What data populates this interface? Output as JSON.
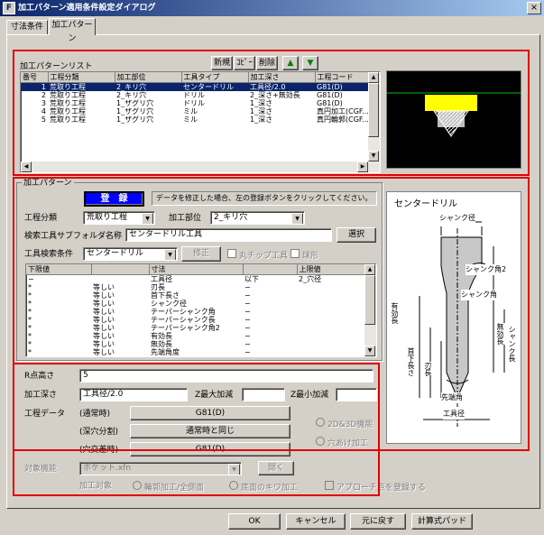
{
  "window": {
    "title": "加工パターン適用条件設定ダイアログ",
    "icon_letter": "F",
    "close": "×"
  },
  "tabs": [
    "寸法条件",
    "加工パターン"
  ],
  "list_section": {
    "label": "加工パターンリスト",
    "buttons": {
      "new": "新規",
      "copy": "ｺﾋﾟｰ",
      "delete": "削除",
      "up": "▲",
      "down": "▼"
    },
    "columns": [
      "番号",
      "工程分類",
      "加工部位",
      "工具タイプ",
      "加工深さ",
      "工程コード"
    ],
    "rows": [
      [
        "1",
        "荒取り工程",
        "2_キリ穴",
        "センタードリル",
        "工具径/2.0",
        "G81(D)"
      ],
      [
        "2",
        "荒取り工程",
        "2_キリ穴",
        "ドリル",
        "2_深さ+無効長",
        "G81(D)"
      ],
      [
        "3",
        "荒取り工程",
        "1_ザグリ穴",
        "ドリル",
        "1_深さ",
        "G81(D)"
      ],
      [
        "4",
        "荒取り工程",
        "1_ザグリ穴",
        "ミル",
        "1_深さ",
        "真円加工(CGF..."
      ],
      [
        "5",
        "荒取り工程",
        "1_ザグリ穴",
        "ミル",
        "1_深さ",
        "真円輪郭(CGF..."
      ]
    ]
  },
  "pattern_section": {
    "label": "加工パターン",
    "register_button": "登　録",
    "register_hint": "データを修正した場合、左の登録ボタンをクリックしてください。",
    "process_class_label": "工程分類",
    "process_class_value": "荒取り工程",
    "machining_part_label": "加工部位",
    "machining_part_value": "2_キリ穴",
    "subfolder_label": "検索工具サブフォルダ名称",
    "subfolder_value": "センタードリル工具",
    "select_button": "選択",
    "tool_search_label": "工具検索条件",
    "tool_search_value": "センタードリル",
    "modify_button": "修正",
    "round_tip_label": "丸チップ工具",
    "chamfer_label": "球形",
    "cond_columns": [
      "下限値",
      "",
      "寸法",
      "",
      "上限値"
    ],
    "cond_rows": [
      [
        "−",
        "",
        "工具径",
        "以下",
        "2_穴径"
      ],
      [
        "*",
        "等しい",
        "刃長",
        "−",
        ""
      ],
      [
        "*",
        "等しい",
        "首下長さ",
        "−",
        ""
      ],
      [
        "*",
        "等しい",
        "シャンク径",
        "−",
        ""
      ],
      [
        "*",
        "等しい",
        "テーパーシャンク角",
        "−",
        ""
      ],
      [
        "*",
        "等しい",
        "テーパーシャンク長",
        "−",
        ""
      ],
      [
        "*",
        "等しい",
        "テーパーシャンク角2",
        "−",
        ""
      ],
      [
        "*",
        "等しい",
        "有効長",
        "−",
        ""
      ],
      [
        "*",
        "等しい",
        "無効長",
        "−",
        ""
      ],
      [
        "*",
        "等しい",
        "先端角度",
        "−",
        ""
      ]
    ]
  },
  "tool_diagram": {
    "title": "センタードリル",
    "labels": {
      "shank_dia": "シャンク径",
      "shank_angle2": "シャンク角2",
      "shank_angle": "シャンク角",
      "effective": "有効長",
      "neck_length": "首下長さ",
      "blade_length": "刃長",
      "shank_length": "シャンク長",
      "invalid": "無効長",
      "tip_angle": "先端角",
      "tool_dia": "工具径"
    }
  },
  "lower_section": {
    "r_height_label": "R点高さ",
    "r_height_value": "5",
    "depth_label": "加工深さ",
    "depth_value": "工具径/2.0",
    "z_max_label": "Z最大加減",
    "z_max_value": "",
    "z_min_label": "Z最小加減",
    "z_min_value": "",
    "process_data_label": "工程データ",
    "normal_label": "(通常時)",
    "normal_value": "G81(D)",
    "deep_label": "(深穴分割)",
    "deep_value": "通常時と同じ",
    "cross_label": "(穴交差時)",
    "cross_value": "G81(D)",
    "opt_2d3d": "2D&3D機能",
    "opt_hole": "穴あけ加工",
    "target_func_label": "対象機能",
    "target_func_value": "ポケット.xfn",
    "open_button": "開く",
    "target_label": "加工対象",
    "target_opt1": "輪郭加工/全側面",
    "target_opt2": "底面のキワ加工",
    "approach_label": "アプローチ点を登録する"
  },
  "footer": {
    "ok": "OK",
    "cancel": "キャンセル",
    "restore": "元に戻す",
    "calc_pad": "計算式パッド"
  },
  "colors": {
    "selection": "#0a246a",
    "highlight_red": "#e00000",
    "preview_yellow": "#ffff00",
    "preview_green": "#00c000",
    "register_blue": "#0000ff"
  }
}
